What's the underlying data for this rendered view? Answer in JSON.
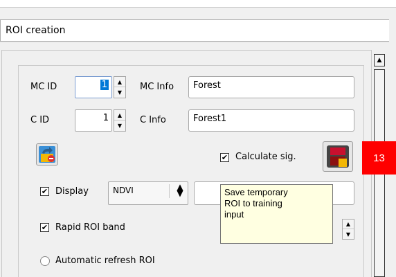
{
  "panel": {
    "title": "ROI creation"
  },
  "mc": {
    "id_label": "MC ID",
    "id_value": "1",
    "info_label": "MC Info",
    "info_value": "Forest"
  },
  "c": {
    "id_label": "C ID",
    "id_value": "1",
    "info_label": "C Info",
    "info_value": "Forest1"
  },
  "calculate_sig": {
    "label": "Calculate sig.",
    "checked": true
  },
  "display": {
    "label": "Display",
    "checked": true,
    "select_value": "NDVI",
    "field_value": ""
  },
  "rapid_roi_band": {
    "label": "Rapid ROI band",
    "checked": true
  },
  "automatic_refresh": {
    "label": "Automatic refresh ROI",
    "checked": false
  },
  "tooltip": {
    "text": "Save temporary\nROI to training\ninput"
  },
  "badge": {
    "value": "13"
  },
  "icons": {
    "undo_roi": "undo-roi-icon",
    "save_roi": "save-roi-icon",
    "check": "✔",
    "spin_up": "▲",
    "spin_down": "▼",
    "scroll_up": "▲"
  }
}
